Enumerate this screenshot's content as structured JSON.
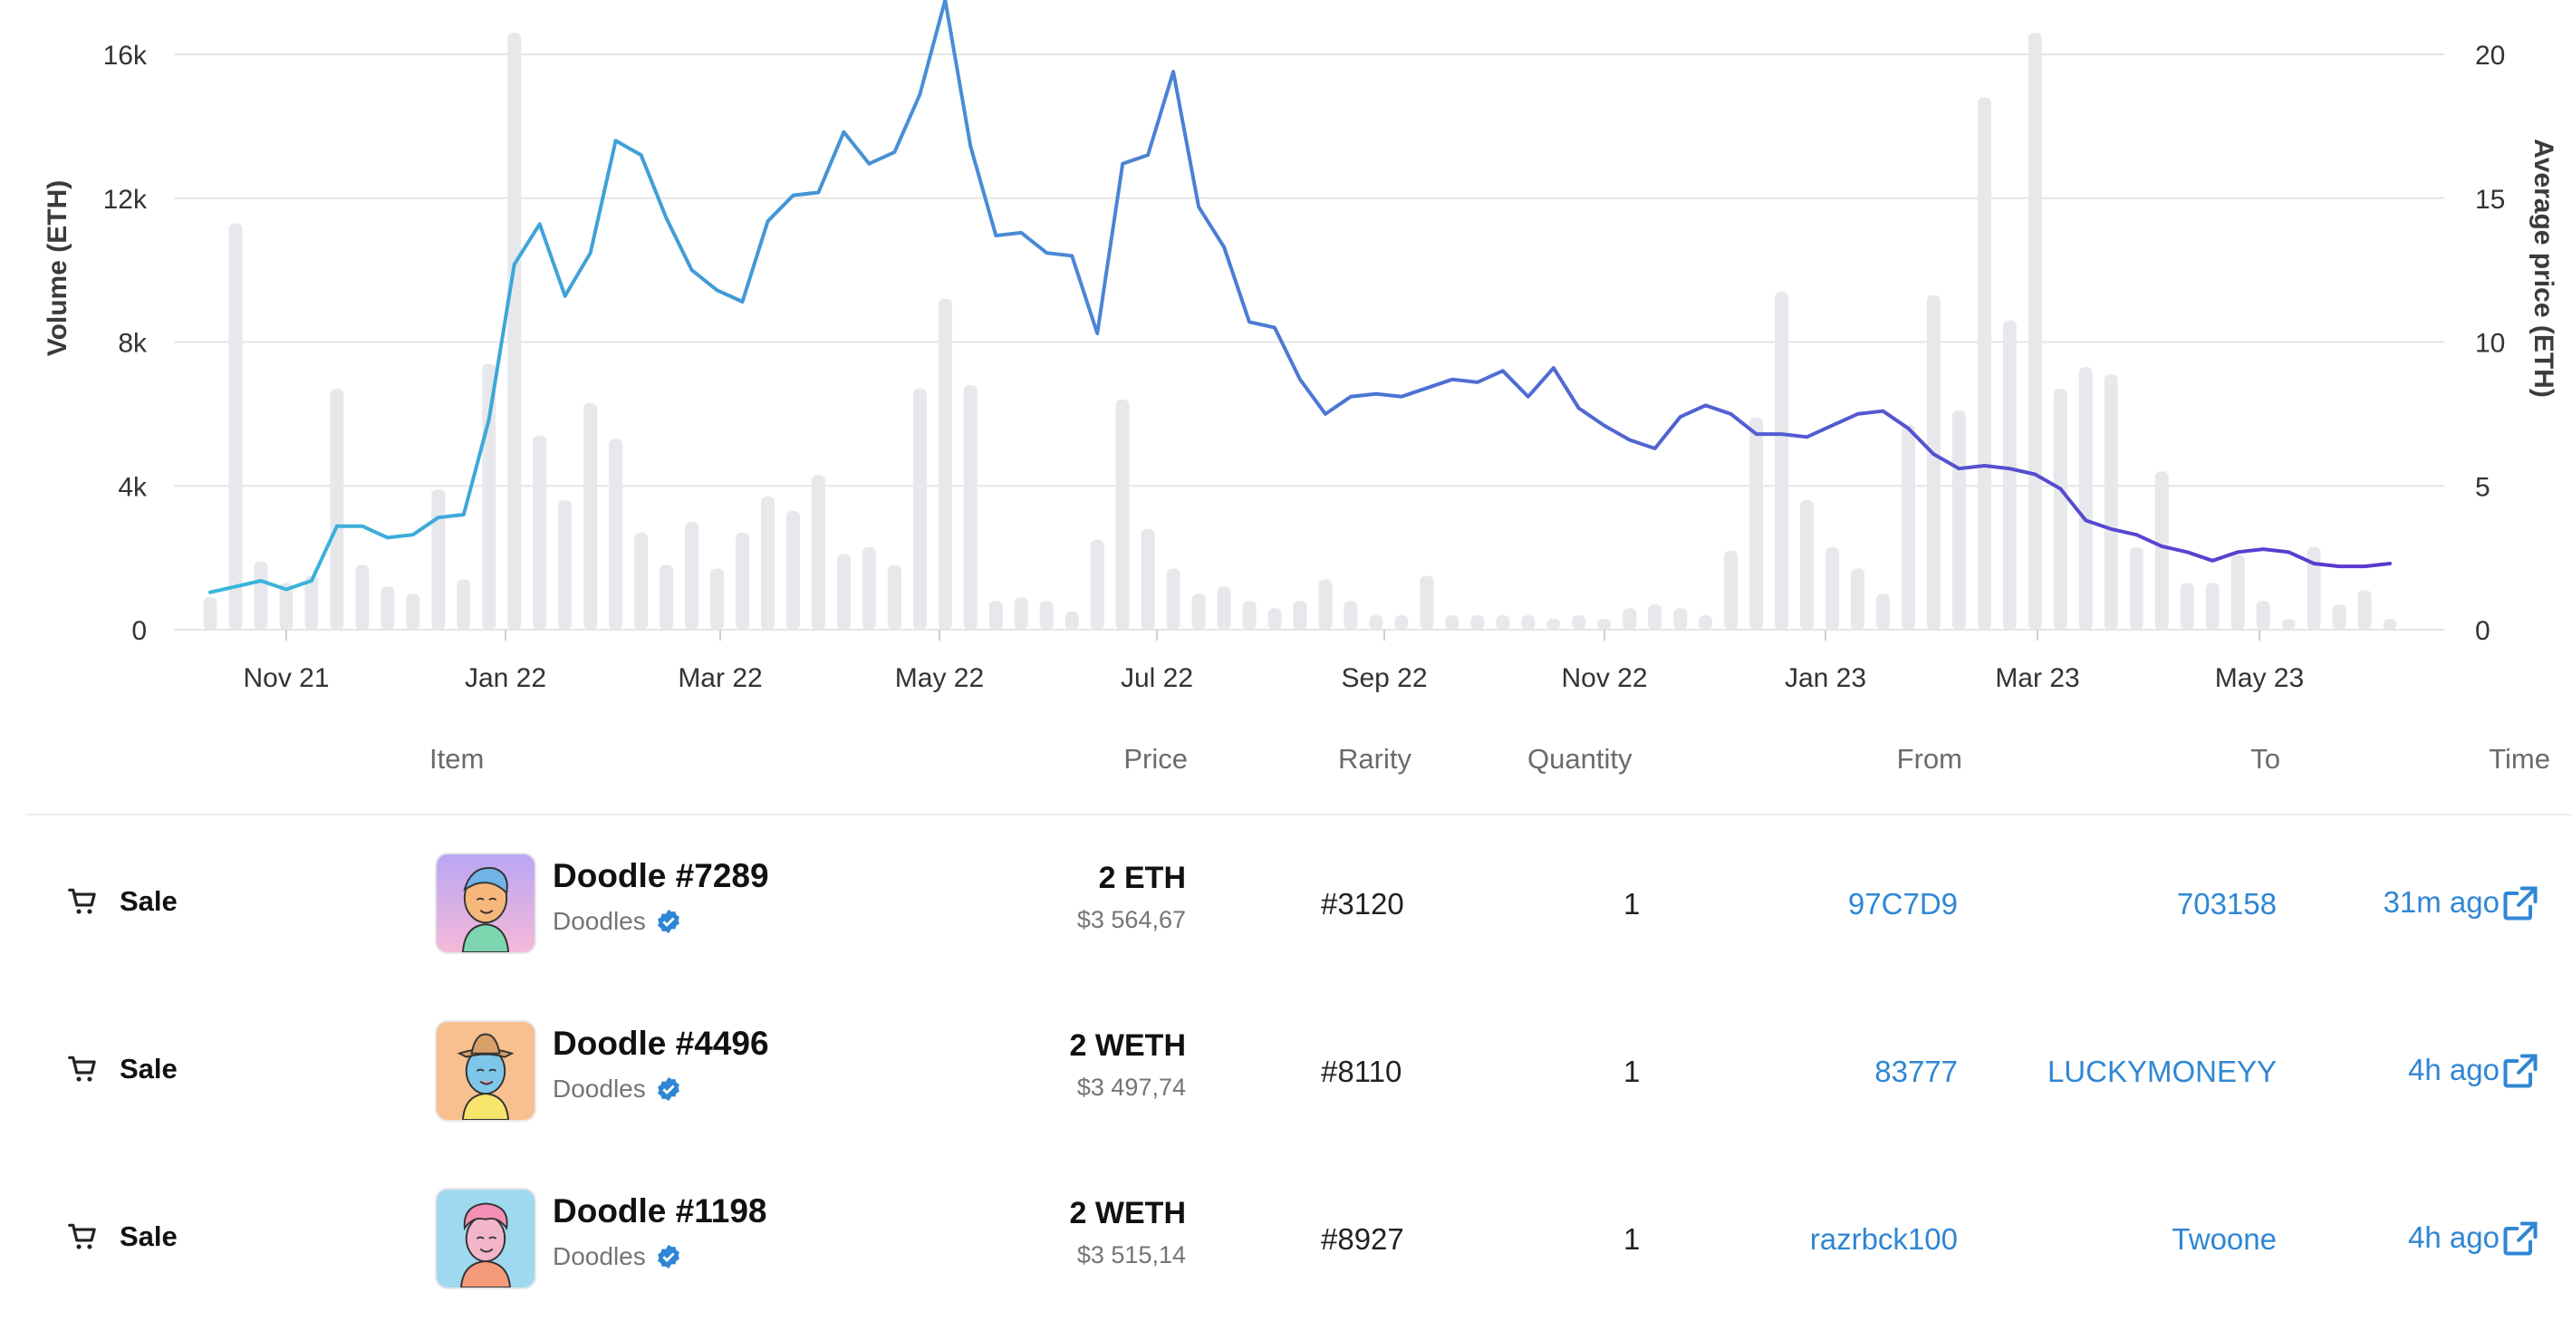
{
  "chart_data": {
    "type": "bar+line",
    "ylabel_left": "Volume (ETH)",
    "ylabel_right": "Average price (ETH)",
    "left_ticks": [
      "0",
      "4k",
      "8k",
      "12k",
      "16k"
    ],
    "right_ticks": [
      "0",
      "5",
      "10",
      "15",
      "20"
    ],
    "x_ticks": [
      "Nov 21",
      "Jan 22",
      "Mar 22",
      "May 22",
      "Jul 22",
      "Sep 22",
      "Nov 22",
      "Jan 23",
      "Mar 23",
      "May 23"
    ],
    "ylim_left": [
      0,
      16000
    ],
    "ylim_right": [
      0,
      20
    ],
    "grid": true,
    "series": [
      {
        "type": "bar",
        "values": [
          900,
          11300,
          1900,
          1300,
          1500,
          6700,
          1800,
          1200,
          1000,
          3900,
          1400,
          7400,
          16600,
          5400,
          3600,
          6300,
          5300,
          2700,
          1800,
          3000,
          1700,
          2700,
          3700,
          3300,
          4300,
          2100,
          2300,
          1800,
          6700,
          9200,
          6800,
          800,
          900,
          800,
          500,
          2500,
          6400,
          2800,
          1700,
          1000,
          1200,
          800,
          600,
          800,
          1400,
          800,
          400,
          400,
          1500,
          400,
          400,
          400,
          400,
          300,
          400,
          300,
          600,
          700,
          600,
          400,
          2200,
          5900,
          9400,
          3600,
          2300,
          1700,
          1000,
          5700,
          9300,
          6100,
          14800,
          8600,
          16600,
          6700,
          7300,
          7100,
          2300,
          4400,
          1300,
          1300,
          2100,
          800,
          300,
          2300,
          700,
          1100,
          300
        ]
      },
      {
        "type": "line",
        "values": [
          1.3,
          1.5,
          1.7,
          1.4,
          1.7,
          3.6,
          3.6,
          3.2,
          3.3,
          3.9,
          4.0,
          7.3,
          12.7,
          14.1,
          11.6,
          13.1,
          17.0,
          16.5,
          14.3,
          12.5,
          11.8,
          11.4,
          14.2,
          15.1,
          15.2,
          17.3,
          16.2,
          16.6,
          18.6,
          22.2,
          16.8,
          13.7,
          13.8,
          13.1,
          13.0,
          10.3,
          16.2,
          16.5,
          19.4,
          14.7,
          13.3,
          10.7,
          10.5,
          8.7,
          7.5,
          8.1,
          8.2,
          8.1,
          8.4,
          8.7,
          8.6,
          9.0,
          8.1,
          9.1,
          7.7,
          7.1,
          6.6,
          6.3,
          7.4,
          7.8,
          7.5,
          6.8,
          6.8,
          6.7,
          7.1,
          7.5,
          7.6,
          7.0,
          6.1,
          5.6,
          5.7,
          5.6,
          5.4,
          4.9,
          3.8,
          3.5,
          3.3,
          2.9,
          2.7,
          2.4,
          2.7,
          2.8,
          2.7,
          2.3,
          2.2,
          2.2,
          2.3
        ]
      }
    ]
  },
  "table": {
    "headers": {
      "item": "Item",
      "price": "Price",
      "rarity": "Rarity",
      "quantity": "Quantity",
      "from": "From",
      "to": "To",
      "time": "Time"
    },
    "rows": [
      {
        "event": "Sale",
        "name": "Doodle #7289",
        "collection": "Doodles",
        "price": "2 ETH",
        "usd": "$3 564,67",
        "rarity": "#3120",
        "quantity": "1",
        "from": "97C7D9",
        "to": "703158",
        "time": "31m ago",
        "thumb_bg": "#c9b8f2"
      },
      {
        "event": "Sale",
        "name": "Doodle #4496",
        "collection": "Doodles",
        "price": "2 WETH",
        "usd": "$3 497,74",
        "rarity": "#8110",
        "quantity": "1",
        "from": "83777",
        "to": "LUCKYMONEYY",
        "time": "4h ago",
        "thumb_bg": "#f7c08e"
      },
      {
        "event": "Sale",
        "name": "Doodle #1198",
        "collection": "Doodles",
        "price": "2 WETH",
        "usd": "$3 515,14",
        "rarity": "#8927",
        "quantity": "1",
        "from": "razrbck100",
        "to": "Twoone",
        "time": "4h ago",
        "thumb_bg": "#9fd9ef"
      }
    ]
  },
  "colors": {
    "bar": "#e6e8eb",
    "grid": "#e5e5e5",
    "link": "#2f86d4",
    "line_start": "#38b6dc",
    "line_mid": "#4a86d4",
    "line_end": "#5a37cf",
    "verified": "#2f86d4"
  },
  "icons": {
    "event": "cart-icon",
    "verified": "verified-badge-icon",
    "external": "external-link-icon"
  }
}
